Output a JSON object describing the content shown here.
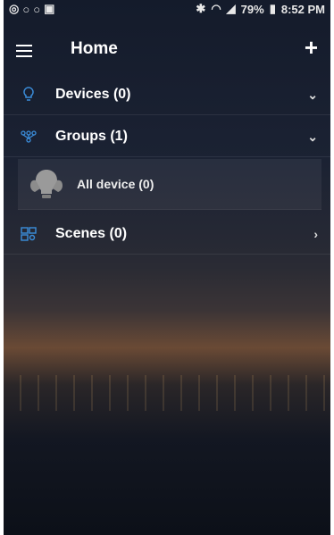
{
  "status": {
    "battery": "79%",
    "time": "8:52 PM"
  },
  "header": {
    "title": "Home"
  },
  "sections": [
    {
      "label": "Devices (0)"
    },
    {
      "label": "Groups (1)"
    },
    {
      "label": "Scenes (0)"
    }
  ],
  "groups": {
    "items": [
      {
        "label": "All device (0)"
      }
    ]
  },
  "colors": {
    "accent": "#3b8edc"
  },
  "icons": {
    "devices": "bulb-outline-icon",
    "groups": "group-nodes-icon",
    "scenes": "scenes-grid-icon",
    "menu": "hamburger-icon",
    "add": "plus-icon"
  }
}
